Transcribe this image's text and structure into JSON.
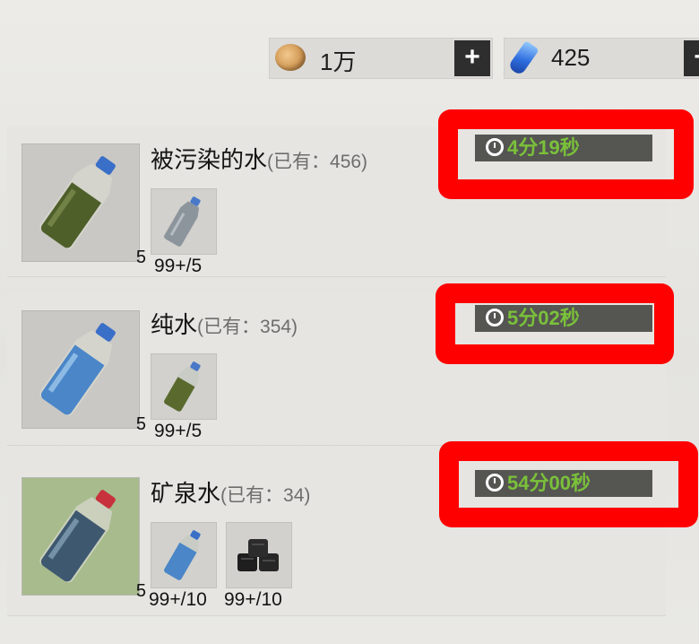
{
  "currencies": {
    "gold": {
      "value": "1万",
      "icon": "coin-icon"
    },
    "gem": {
      "value": "425",
      "icon": "gem-icon"
    },
    "plus_label": "+"
  },
  "recipes": [
    {
      "name": "被污染的水",
      "owned": "(已有：456)",
      "yield": "5",
      "timer": "4分19秒",
      "materials": [
        {
          "icon": "empty-bottle-icon",
          "count": "99+/5"
        }
      ]
    },
    {
      "name": "纯水",
      "owned": "(已有：354)",
      "yield": "5",
      "timer": "5分02秒",
      "materials": [
        {
          "icon": "dirty-water-bottle-icon",
          "count": "99+/5"
        }
      ]
    },
    {
      "name": "矿泉水",
      "owned": "(已有：34)",
      "yield": "5",
      "timer": "54分00秒",
      "materials": [
        {
          "icon": "pure-water-bottle-icon",
          "count": "99+/10"
        },
        {
          "icon": "charcoal-icon",
          "count": "99+/10"
        }
      ]
    }
  ],
  "colors": {
    "timer_text": "#7ac13a",
    "highlight_frame": "#ff0000"
  }
}
